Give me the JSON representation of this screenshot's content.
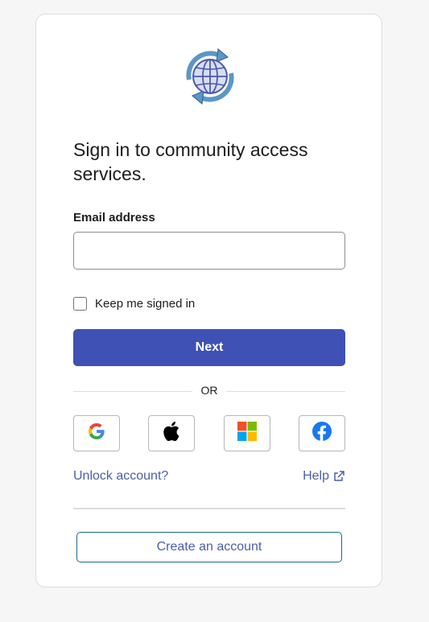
{
  "brand": {
    "logo_icon": "globe-refresh-icon",
    "colors": {
      "primary": "#3f51b5",
      "link": "#4b5fa8",
      "logo_ring": "#5b97c6",
      "logo_fill": "#d6def2"
    }
  },
  "signin": {
    "title": "Sign in to community access services.",
    "email_label": "Email address",
    "email_value": "",
    "email_placeholder": "",
    "remember_label": "Keep me signed in",
    "remember_checked": false,
    "next_label": "Next",
    "divider_text": "OR"
  },
  "social": [
    {
      "name": "Google",
      "icon": "google-icon"
    },
    {
      "name": "Apple",
      "icon": "apple-icon"
    },
    {
      "name": "Microsoft",
      "icon": "microsoft-icon"
    },
    {
      "name": "Facebook",
      "icon": "facebook-icon"
    }
  ],
  "links": {
    "unlock": "Unlock account?",
    "help": "Help",
    "help_icon": "external-link-icon"
  },
  "footer": {
    "create_account_label": "Create an account"
  }
}
